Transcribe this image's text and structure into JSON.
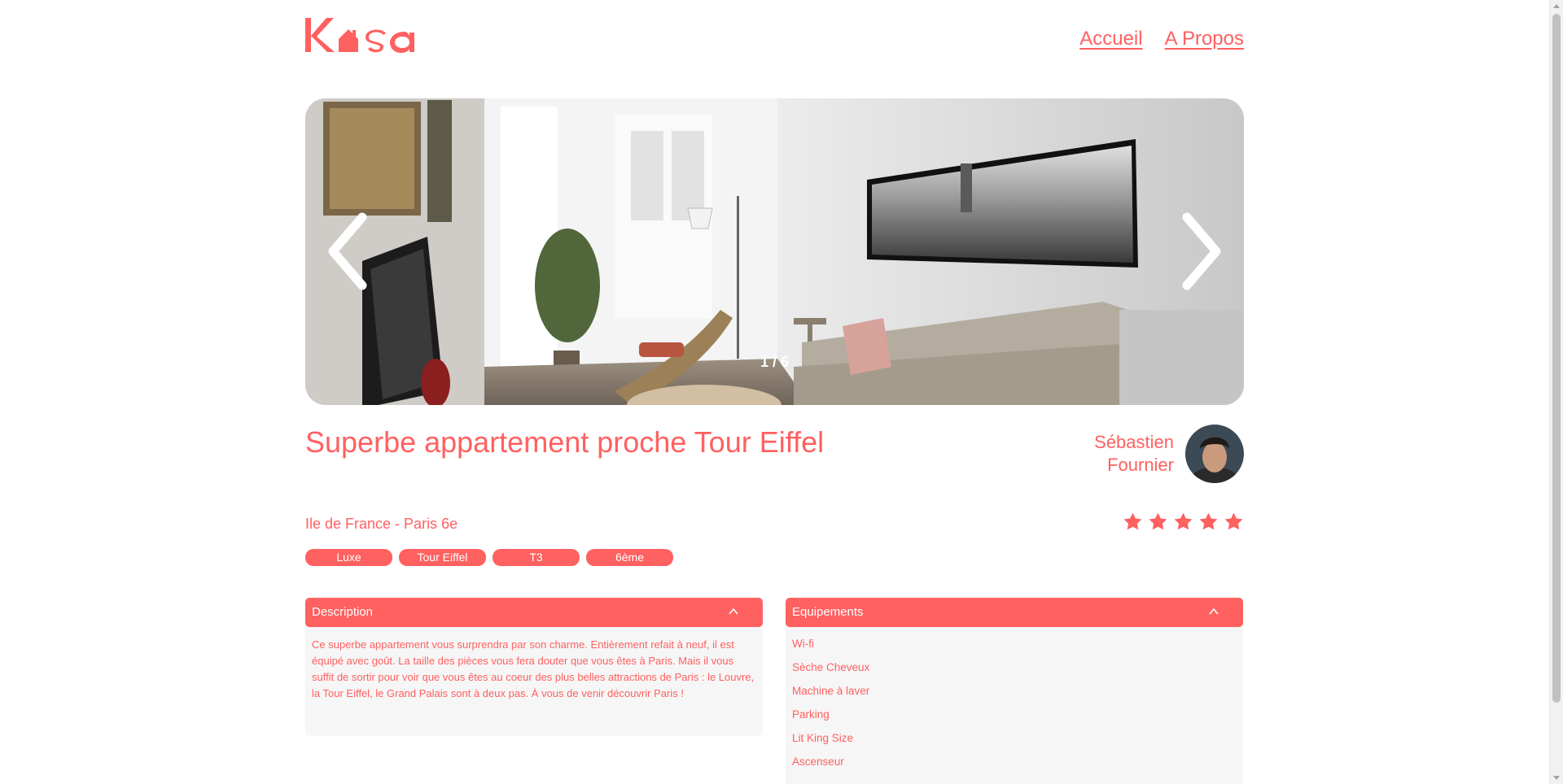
{
  "brand": {
    "logo_text": "Kasa",
    "accent_color": "#FF6060",
    "bg_light": "#F6F6F6"
  },
  "nav": {
    "home": "Accueil",
    "about": "A Propos"
  },
  "gallery": {
    "counter": "1 / 6",
    "prev_icon": "chevron-left-icon",
    "next_icon": "chevron-right-icon"
  },
  "listing": {
    "title": "Superbe appartement proche Tour Eiffel",
    "location": "Ile de France - Paris 6e",
    "tags": [
      "Luxe",
      "Tour Eiffel",
      "T3",
      "6ème"
    ],
    "host": {
      "first_name": "Sébastien",
      "last_name": "Fournier"
    },
    "rating": 5,
    "rating_max": 5
  },
  "description": {
    "title": "Description",
    "text": "Ce superbe appartement vous surprendra par son charme. Entièrement refait à neuf, il est équipé avec goût. La taille des pièces vous fera douter que vous êtes à Paris. Mais il vous suffit de sortir pour voir que vous êtes au coeur des plus belles attractions de Paris : le Louvre, la Tour Eiffel, le Grand Palais sont à deux pas. À vous de venir découvrir Paris !"
  },
  "equipments": {
    "title": "Equipements",
    "items": [
      "Wi-fi",
      "Sèche Cheveux",
      "Machine à laver",
      "Parking",
      "Lit King Size",
      "Ascenseur"
    ]
  }
}
